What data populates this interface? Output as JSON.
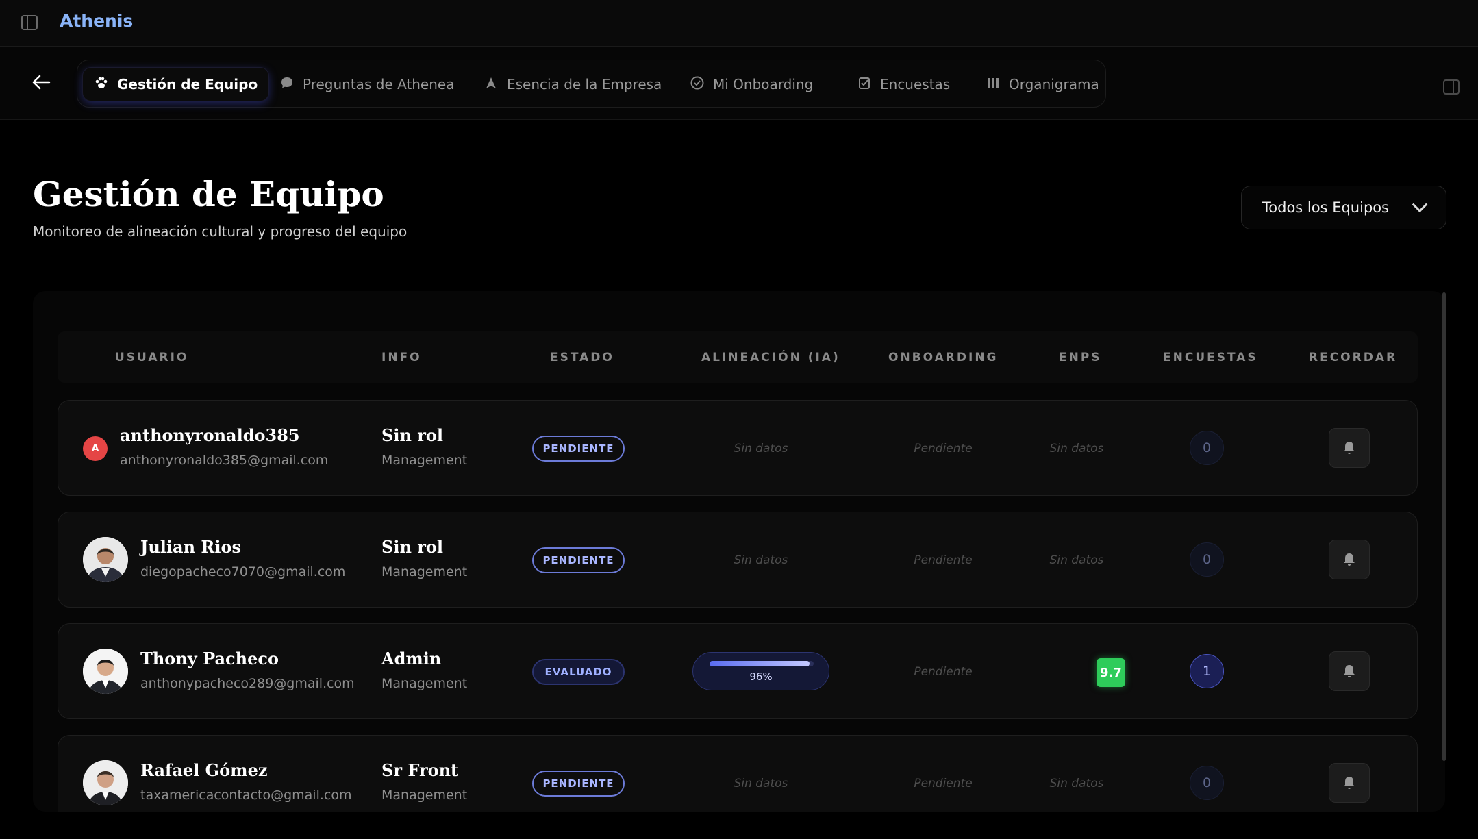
{
  "app": {
    "brand": "Athenis"
  },
  "nav": {
    "tabs": [
      {
        "label": "Gestión de Equipo",
        "icon": "paw-icon",
        "active": true
      },
      {
        "label": "Preguntas de Athenea",
        "icon": "chat-icon"
      },
      {
        "label": "Esencia de la Empresa",
        "icon": "navigation-arrow-icon"
      },
      {
        "label": "Mi Onboarding",
        "icon": "check-circle-icon"
      },
      {
        "label": "Encuestas",
        "icon": "checklist-icon"
      },
      {
        "label": "Organigrama",
        "icon": "columns-icon"
      }
    ]
  },
  "header": {
    "title": "Gestión de Equipo",
    "subtitle": "Monitoreo de alineación cultural y progreso del equipo",
    "team_filter": "Todos los Equipos"
  },
  "table": {
    "columns": [
      "USUARIO",
      "INFO",
      "ESTADO",
      "ALINEACIÓN (IA)",
      "ONBOARDING",
      "ENPS",
      "ENCUESTAS",
      "RECORDAR"
    ],
    "rows": [
      {
        "name": "anthonyronaldo385",
        "email": "anthonyronaldo385@gmail.com",
        "avatar_letter": "A",
        "role": "Sin rol",
        "dept": "Management",
        "status": "PENDIENTE",
        "alignment": "Sin datos",
        "onboarding": "Pendiente",
        "enps": "Sin datos",
        "surveys": "0"
      },
      {
        "name": "Julian Rios",
        "email": "diegopacheco7070@gmail.com",
        "role": "Sin rol",
        "dept": "Management",
        "status": "PENDIENTE",
        "alignment": "Sin datos",
        "onboarding": "Pendiente",
        "enps": "Sin datos",
        "surveys": "0"
      },
      {
        "name": "Thony Pacheco",
        "email": "anthonypacheco289@gmail.com",
        "role": "Admin",
        "dept": "Management",
        "status": "EVALUADO",
        "alignment": "96%",
        "alignment_value": 0.96,
        "onboarding": "Pendiente",
        "enps": "9.7",
        "surveys": "1"
      },
      {
        "name": "Rafael Gómez",
        "email": "taxamericacontacto@gmail.com",
        "role": "Sr Front",
        "dept": "Management",
        "status": "PENDIENTE",
        "alignment": "Sin datos",
        "onboarding": "Pendiente",
        "enps": "Sin datos",
        "surveys": "0"
      }
    ]
  }
}
